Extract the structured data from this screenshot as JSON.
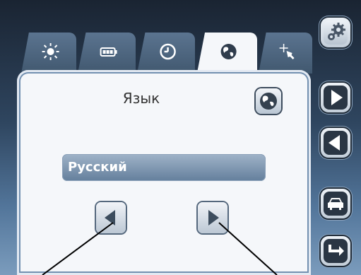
{
  "header": {
    "tabs": [
      {
        "icon": "brightness-icon",
        "active": false
      },
      {
        "icon": "battery-icon",
        "active": false
      },
      {
        "icon": "clock-icon",
        "active": false
      },
      {
        "icon": "globe-icon",
        "active": true
      },
      {
        "icon": "touch-calibration-icon",
        "active": false
      }
    ]
  },
  "sidebar": {
    "buttons": [
      {
        "icon": "settings-gears-icon"
      },
      {
        "icon": "next-arrow-icon"
      },
      {
        "icon": "previous-arrow-icon"
      },
      {
        "icon": "car-icon"
      },
      {
        "icon": "exit-arrow-icon"
      }
    ]
  },
  "main": {
    "title": "Язык",
    "language_value": "Русский"
  },
  "colors": {
    "panel": "#f5f7fa",
    "tab_inactive": "#4d647c",
    "field": "#7f98b2",
    "accent_dark": "#2a3644"
  }
}
